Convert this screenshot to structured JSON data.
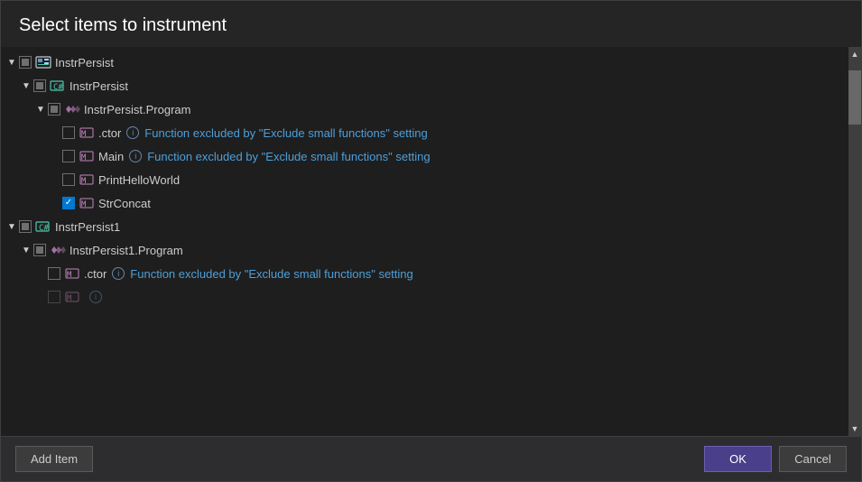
{
  "dialog": {
    "title": "Select items to instrument",
    "add_item_label": "Add Item",
    "ok_label": "OK",
    "cancel_label": "Cancel"
  },
  "tree": {
    "nodes": [
      {
        "id": "instrpersist-assembly",
        "level": 0,
        "expanded": true,
        "checkbox": "indeterminate",
        "icon": "assembly",
        "label": "InstrPersist",
        "children": [
          {
            "id": "instrpersist-project",
            "level": 1,
            "expanded": true,
            "checkbox": "indeterminate",
            "icon": "class",
            "label": "InstrPersist",
            "children": [
              {
                "id": "instrpersist-program",
                "level": 2,
                "expanded": true,
                "checkbox": "indeterminate",
                "icon": "namespace",
                "label": "InstrPersist.Program",
                "children": [
                  {
                    "id": "instrpersist-ctor",
                    "level": 3,
                    "expanded": false,
                    "checkbox": "unchecked",
                    "icon": "method",
                    "label": ".ctor",
                    "hasInfo": true,
                    "excluded": true,
                    "excludedText": "Function excluded by \"Exclude small functions\" setting"
                  },
                  {
                    "id": "instrpersist-main",
                    "level": 3,
                    "expanded": false,
                    "checkbox": "unchecked",
                    "icon": "method",
                    "label": "Main",
                    "hasInfo": true,
                    "excluded": true,
                    "excludedText": "Function excluded by \"Exclude small functions\" setting"
                  },
                  {
                    "id": "instrpersist-printhelloworld",
                    "level": 3,
                    "expanded": false,
                    "checkbox": "unchecked",
                    "icon": "method",
                    "label": "PrintHelloWorld",
                    "hasInfo": false,
                    "excluded": false
                  },
                  {
                    "id": "instrpersist-strconcat",
                    "level": 3,
                    "expanded": false,
                    "checkbox": "checked",
                    "icon": "method",
                    "label": "StrConcat",
                    "hasInfo": false,
                    "excluded": false
                  }
                ]
              }
            ]
          }
        ]
      },
      {
        "id": "instrpersist1-assembly",
        "level": 0,
        "expanded": true,
        "checkbox": "indeterminate",
        "icon": "class",
        "label": "InstrPersist1",
        "children": [
          {
            "id": "instrpersist1-program",
            "level": 1,
            "expanded": true,
            "checkbox": "indeterminate",
            "icon": "namespace",
            "label": "InstrPersist1.Program",
            "children": [
              {
                "id": "instrpersist1-ctor",
                "level": 2,
                "expanded": false,
                "checkbox": "unchecked",
                "icon": "method",
                "label": ".ctor",
                "hasInfo": true,
                "excluded": true,
                "excludedText": "Function excluded by \"Exclude small functions\" setting"
              },
              {
                "id": "instrpersist1-main",
                "level": 2,
                "expanded": false,
                "checkbox": "unchecked",
                "icon": "method",
                "label": "",
                "hasInfo": true,
                "excluded": true,
                "excludedText": ""
              }
            ]
          }
        ]
      }
    ]
  }
}
